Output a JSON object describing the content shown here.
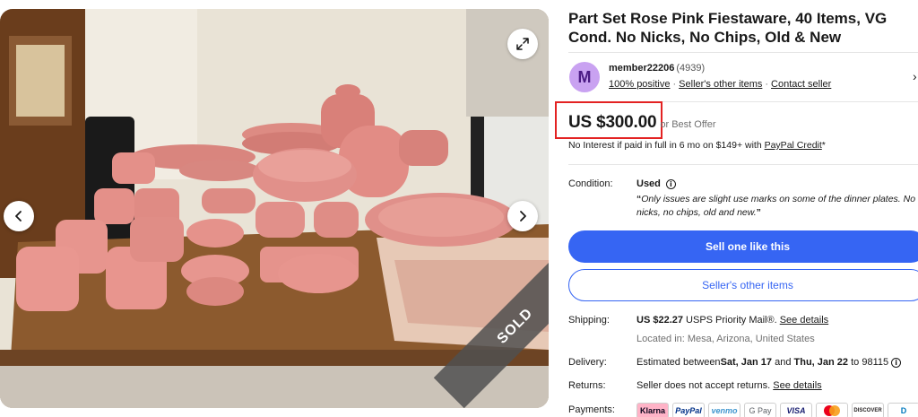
{
  "listing": {
    "title": "Part Set Rose Pink Fiestaware, 40 Items, VG Cond. No Nicks, No Chips, Old & New",
    "sold_ribbon": "SOLD"
  },
  "seller": {
    "avatar_initial": "M",
    "name": "member22206",
    "score": "(4939)",
    "positive": "100% positive",
    "other_items_link": "Seller's other items",
    "contact_link": "Contact seller"
  },
  "price": {
    "amount": "US $300.00",
    "best_offer": "or Best Offer",
    "credit_prefix": "No Interest if paid in full in 6 mo on $149+ with ",
    "credit_link": "PayPal Credit",
    "credit_suffix": "*"
  },
  "condition": {
    "label": "Condition:",
    "value": "Used",
    "quote_open": "“",
    "quote": "Only issues are slight use marks on some of the dinner plates. No nicks, no chips, old and new.",
    "quote_close": "”"
  },
  "buttons": {
    "sell_one": "Sell one like this",
    "other_items": "Seller's other items"
  },
  "shipping": {
    "label": "Shipping:",
    "price": "US $22.27",
    "service": " USPS Priority Mail®. ",
    "details_link": "See details",
    "location": "Located in: Mesa, Arizona, United States"
  },
  "delivery": {
    "label": "Delivery:",
    "text_prefix": "Estimated between ",
    "date_start": "Sat, Jan 17",
    "text_and": " and ",
    "date_end": "Thu, Jan 22",
    "text_to": " to 98115 "
  },
  "returns": {
    "label": "Returns:",
    "text": "Seller does not accept returns. ",
    "details_link": "See details"
  },
  "payments": {
    "label": "Payments:",
    "methods": [
      "Klarna",
      "PayPal",
      "venmo",
      "G Pay",
      "VISA",
      "MC",
      "DISCOVER",
      "D"
    ]
  },
  "icons": {
    "expand": "expand-icon",
    "prev": "chevron-left-icon",
    "next": "chevron-right-icon",
    "seller_chevron": "chevron-right-icon",
    "info": "info-icon"
  },
  "colors": {
    "primary_blue": "#3665f3",
    "highlight_red": "#e32222",
    "avatar_bg": "#c9a2f1",
    "avatar_fg": "#4b1b84"
  }
}
